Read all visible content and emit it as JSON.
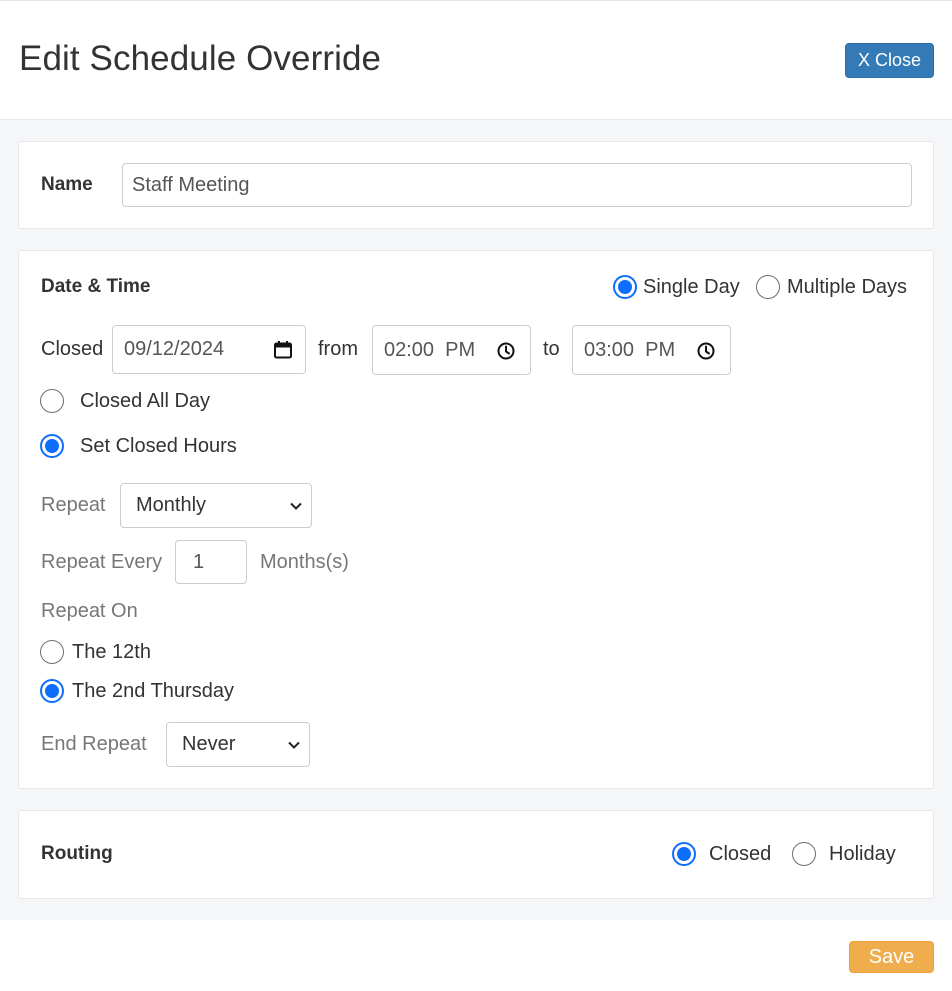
{
  "header": {
    "title": "Edit Schedule Override",
    "close_label": "X Close"
  },
  "name_section": {
    "label": "Name",
    "value": "Staff Meeting"
  },
  "date_section": {
    "title": "Date & Time",
    "mode_options": [
      {
        "label": "Single Day",
        "selected": true
      },
      {
        "label": "Multiple Days",
        "selected": false
      }
    ],
    "closed_label": "Closed",
    "date_value": "09/12/2024",
    "from_label": "from",
    "from_time": "02:00  PM",
    "to_label": "to",
    "to_time": "03:00  PM",
    "hours_options": [
      {
        "label": "Closed All Day",
        "selected": false
      },
      {
        "label": "Set Closed Hours",
        "selected": true
      }
    ],
    "repeat_label": "Repeat",
    "repeat_value": "Monthly",
    "repeat_every_label": "Repeat Every",
    "repeat_every_value": "1",
    "repeat_every_unit": "Months(s)",
    "repeat_on_label": "Repeat On",
    "repeat_on_options": [
      {
        "label": "The 12th",
        "selected": false
      },
      {
        "label": "The 2nd Thursday",
        "selected": true
      }
    ],
    "end_repeat_label": "End Repeat",
    "end_repeat_value": "Never"
  },
  "routing_section": {
    "title": "Routing",
    "options": [
      {
        "label": "Closed",
        "selected": true
      },
      {
        "label": "Holiday",
        "selected": false
      }
    ]
  },
  "footer": {
    "save_label": "Save"
  },
  "colors": {
    "primary": "#337ab7",
    "radio_selected": "#0d6efd",
    "save": "#f0ad4e"
  },
  "icons": [
    "calendar-icon",
    "clock-icon",
    "chevron-down-icon"
  ]
}
